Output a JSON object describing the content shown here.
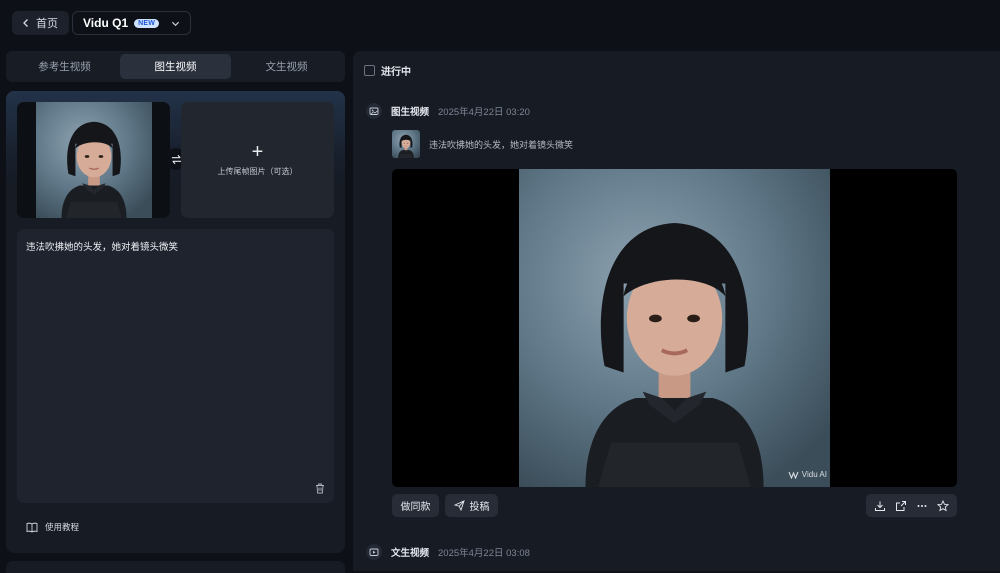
{
  "topbar": {
    "home_label": "首页",
    "model_name": "Vidu Q1",
    "model_badge": "NEW"
  },
  "left": {
    "tabs": [
      {
        "label": "参考生视频",
        "active": false
      },
      {
        "label": "图生视频",
        "active": true
      },
      {
        "label": "文生视频",
        "active": false
      }
    ],
    "upload_end_frame_label": "上传尾帧图片（可选）",
    "prompt_text": "违法吹拂她的头发，她对着镜头微笑",
    "tutorial_label": "使用教程"
  },
  "right": {
    "status_label": "进行中",
    "entries": [
      {
        "type": "图生视频",
        "time": "2025年4月22日 03:20",
        "prompt": "违法吹拂她的头发，她对着镜头微笑",
        "watermark": "Vidu AI",
        "actions": {
          "same_style": "做同款",
          "submit": "投稿"
        }
      },
      {
        "type": "文生视频",
        "time": "2025年4月22日 03:08"
      }
    ]
  },
  "icons": [
    "chevron-left-icon",
    "chevron-down-icon",
    "swap-icon",
    "plus-icon",
    "trash-icon",
    "book-icon",
    "image-video-icon",
    "text-video-icon",
    "send-icon",
    "download-icon",
    "share-icon",
    "more-icon",
    "star-icon",
    "vidu-logo-icon"
  ],
  "colors": {
    "background": "#0d1117",
    "panel": "#161b24",
    "accent_new": "#1a56d6"
  }
}
